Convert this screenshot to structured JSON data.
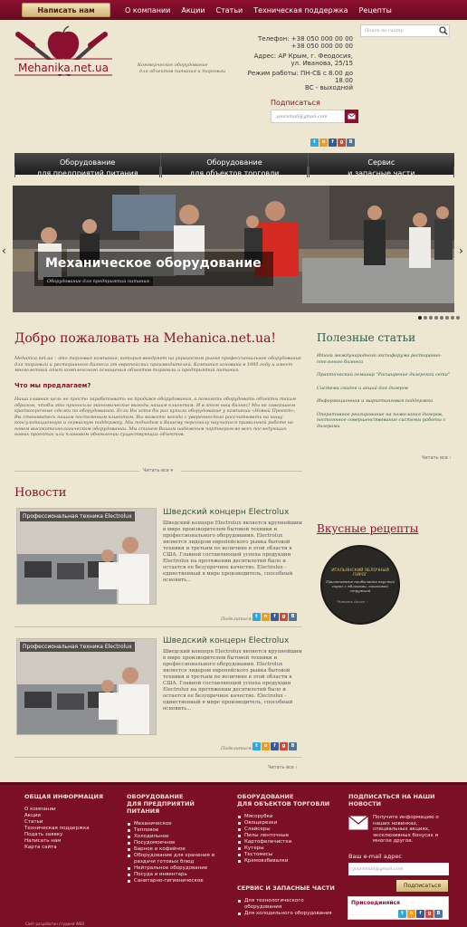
{
  "topbar": {
    "write_button": "Написать нам",
    "nav": [
      "О компании",
      "Акции",
      "Статьи",
      "Техническая поддержка",
      "Рецепты"
    ]
  },
  "header": {
    "logo_text": "Mehanika.net.ua",
    "tagline_1": "Коммерческое оборудование",
    "tagline_2": "для объектов питания и торговли",
    "phone_1": "Телефон: +38 050 000 00 00",
    "phone_2": "+38 050 000 00 00",
    "address_1": "Адрес: АР Крым, г. Феодосия,",
    "address_2": "ул. Иванова, 25/15",
    "hours_1": "Режим работы: ПН-СБ с 8.00 до",
    "hours_2": "18.00",
    "hours_3": "ВС - выходной",
    "search_placeholder": "Поиск по сайту",
    "subscribe_title": "Подписаться",
    "subscribe_placeholder": "youremail@gmail.com"
  },
  "mainnav": [
    {
      "line1": "Оборудование",
      "line2": "для предприятий питания"
    },
    {
      "line1": "Оборудование",
      "line2": "для объектов торговли"
    },
    {
      "line1": "Сервис",
      "line2": "и запасные части"
    }
  ],
  "slider": {
    "title": "Механическое оборудование",
    "subtitle": "Оборудование для предприятий питания",
    "prev": "‹",
    "next": "›"
  },
  "welcome": {
    "title": "Добро пожаловать на Mehanica.net.ua!",
    "intro": "Mehanica.net.ua – это торговая компания, которая внедряет на украинском рынке профессиональное оборудование для торговли и ресторанного бизнеса от европейских производителей. Компания основана в 1995 году и имеет многолетний опыт комплексного оснащения объектов торговли и предприятий питания.",
    "offer_title": "Что мы предлагаем?",
    "offer_text": "Наша главная цель не просто зарабатывать на продаже оборудования, а помогать оборудовать объекты таким образом, чтобы это приносило экономические выгоды нашим клиентам. И в этом наш бизнес! Мы не совершаем краткосрочные сделки по оборудованию. Если Вы хотя бы раз купили оборудование у компании «Новый Проект», Вы становитесь нашим постоянным клиентом. Вы можете всегда с уверенностью рассчитывать на нашу консультационную и сервисную поддержку. Мы подходим к Вашему персоналу научиться правильной работе на новом высокотехнологическом оборудовании. Мы станем Вашим надежным партнером во всех последующих новых проектах или плановом обновлении существующих объектов.",
    "more": "Читать все ▾"
  },
  "articles": {
    "title": "Полезные статьи",
    "items": [
      "Итоги международного экспофорума ресторанно-отельного бизнеса",
      "Практический семинар \"Расширение дизерской сети\"",
      "Система скидок и акций для дизеров",
      "Информационная и маркетинговая поддержка",
      "Оперативное реагирование на пожелания дизеров, постоянное совершенствование системы работы с дизерами"
    ],
    "more": "Читать все ›"
  },
  "news": {
    "title": "Новости",
    "items": [
      {
        "image_caption": "Профессиональная техника Electrolux",
        "headline": "Шведский концерн Electrolux",
        "text": "Шведский концерн Electrolux является крупнейшим в мире производителем бытовой техники и профессионального оборудования. Electrolux является лидером европейского рынка бытовой техники и третьим по величине в этой области в США. Главной составляющей успеха продукции Electrolux на протяжении десятилетий было и остается ее безупречное качество. Electrolux - единственный в мире производитель, способный осно­вить...",
        "share_label": "Поделиться:"
      },
      {
        "image_caption": "Профессиональная техника Electrolux",
        "headline": "Шведский концерн Electrolux",
        "text": "Шведский концерн Electrolux является крупнейшим в мире производителем бытовой техники и профессионального оборудования. Electrolux является лидером европейского рынка бытовой техники и третьим по величине в этой области в США. Главной составляющей успеха продукции Electrolux на протяжении десятилетий было и остается ее безупречное качество. Electrolux - единственный в мире производитель, способный осно­вить...",
        "share_label": "Поделиться:"
      }
    ],
    "more": "Читать все ›"
  },
  "recipes": {
    "title": "Вкусные рецепты",
    "name": "ИТАЛЬЯНСКИЙ ЯБЛОЧНЫЙ ПИРОГ",
    "desc": "Приготовьте необычайно вкусный пирог с яблоками, кокосовой стружкой",
    "more": "Читать далее ›"
  },
  "footer": {
    "col1_title": "ОБЩАЯ ИНФОРМАЦИЯ",
    "col1_items": [
      "О компании",
      "Акции",
      "Статьи",
      "Техническая поддержка",
      "Подать заявку",
      "Написать нам",
      "Карта сайта"
    ],
    "col2_title_1": "ОБОРУДОВАНИЕ",
    "col2_title_2": "ДЛЯ ПРЕДПРИЯТИЙ",
    "col2_title_3": "ПИТАНИЯ",
    "col2_items": [
      "Механическое",
      "Тепловое",
      "Холодильное",
      "Посудомоечное",
      "Барное и кофейное",
      "Оборудование для хранения и раздачи готовых блюд",
      "Нейтральное оборудование",
      "Посуда и инвентарь",
      "Санитарно-гигиеническое"
    ],
    "col3_title_1": "ОБОРУДОВАНИЕ",
    "col3_title_2": "ДЛЯ ОБЪЕКТОВ ТОРГОВЛИ",
    "col3_items": [
      "Мясорубки",
      "Овощерезки",
      "Слайсеры",
      "Пилы ленточные",
      "Картофелечистки",
      "Кутеры",
      "Тестомесы",
      "Кремовзбивалки"
    ],
    "col3b_title": "СЕРВИС И ЗАПАСНЫЕ ЧАСТИ",
    "col3b_items": [
      "Для технологического оборудования",
      "Для холодильного оборудования"
    ],
    "col4_title_1": "ПОДПИСАТЬСЯ НА НАШИ",
    "col4_title_2": "НОВОСТИ",
    "col4_text": "Получите информацию о наших новинках, специальных акциях, эксклюзивных бонусах и многое другое.",
    "email_label": "Ваш e-mail адрес",
    "email_placeholder": "youremail@gmail.com",
    "subscribe_button": "Подписаться",
    "join_label": "Присоединяйся",
    "copyright": "Сайт разработан студией WEB"
  },
  "colors": {
    "brand": "#8b1030",
    "accent_green": "#2e5a49",
    "background": "#ede6d0",
    "footer": "#7a0f26"
  }
}
